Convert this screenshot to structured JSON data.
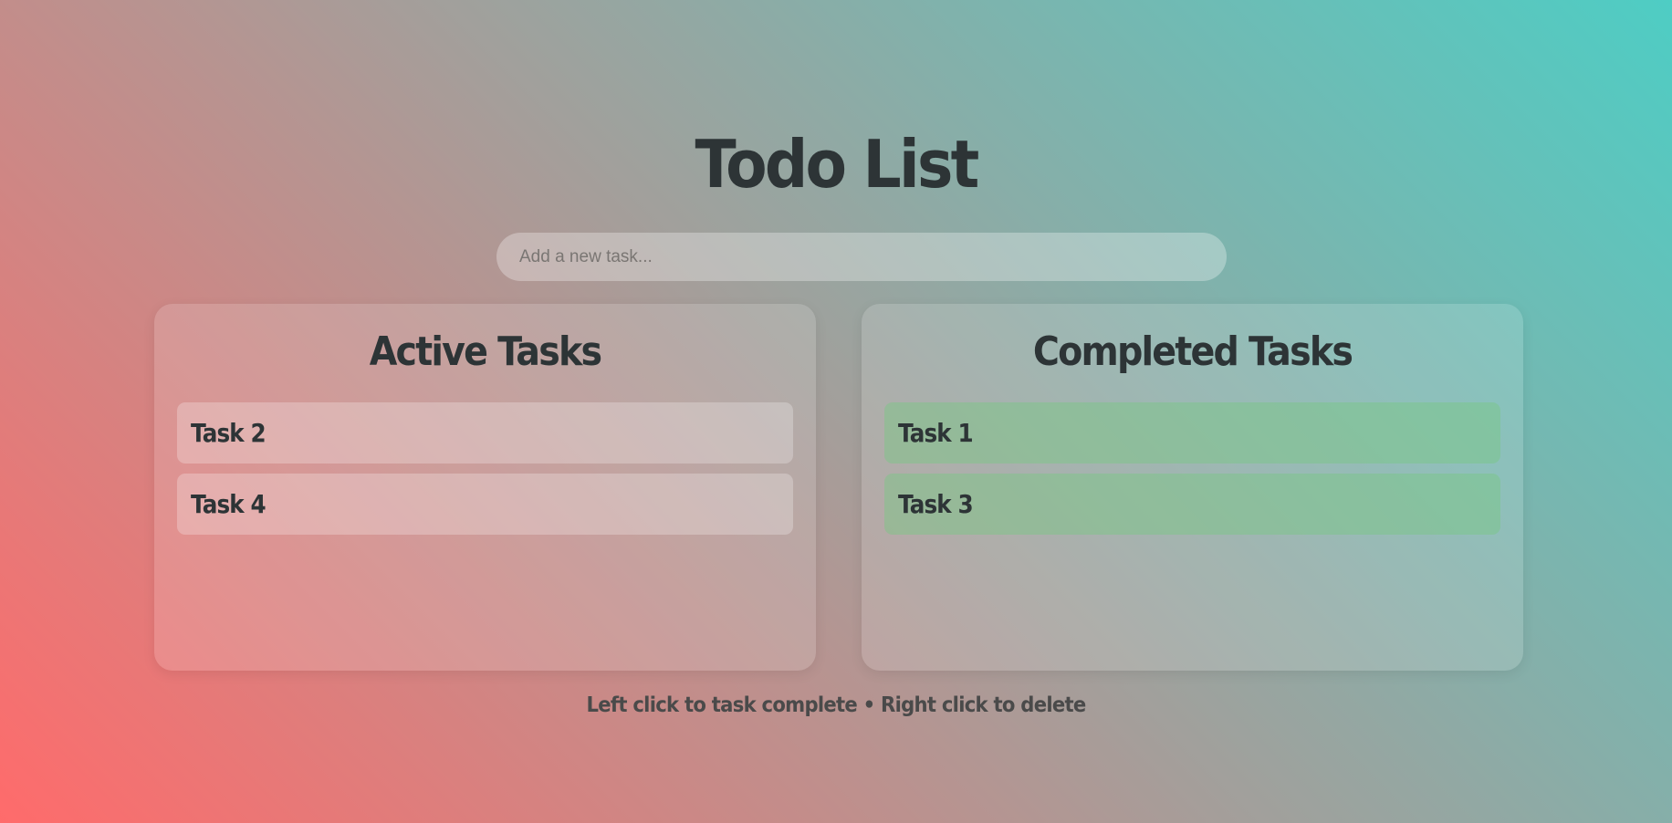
{
  "app": {
    "title": "Todo List"
  },
  "input": {
    "placeholder": "Add a new task...",
    "value": ""
  },
  "active_panel": {
    "title": "Active Tasks",
    "tasks": [
      {
        "label": "Task 2"
      },
      {
        "label": "Task 4"
      }
    ]
  },
  "completed_panel": {
    "title": "Completed Tasks",
    "tasks": [
      {
        "label": "Task 1"
      },
      {
        "label": "Task 3"
      }
    ]
  },
  "footer": {
    "hint": "Left click to task complete • Right click to delete"
  },
  "colors": {
    "text": "#2d3436",
    "gradient_start": "#ff6b6b",
    "gradient_end": "#4ecdc4",
    "completed_item": "#7fc88a"
  }
}
